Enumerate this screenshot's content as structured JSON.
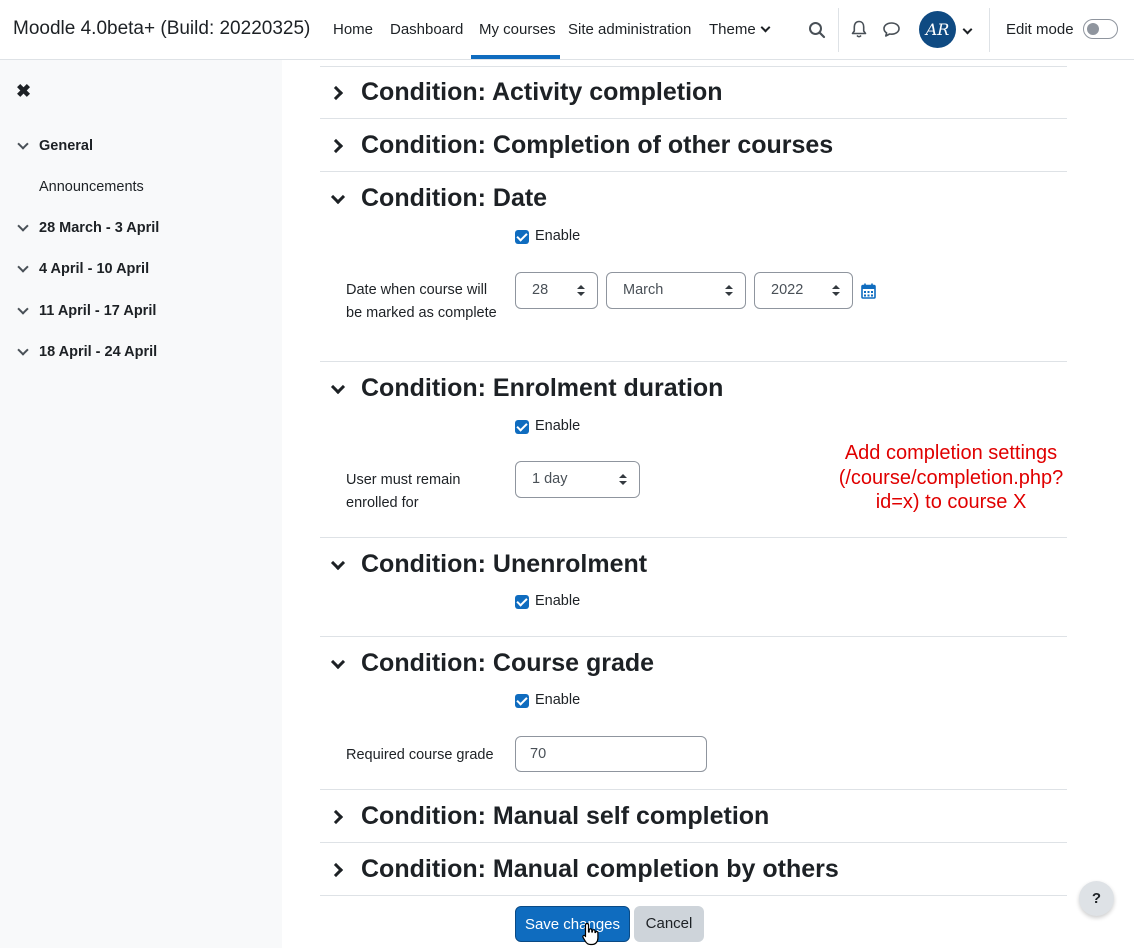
{
  "brand": "Moodle 4.0beta+ (Build: 20220325)",
  "nav": {
    "home": "Home",
    "dashboard": "Dashboard",
    "my_courses": "My courses",
    "site_admin": "Site administration",
    "theme": "Theme",
    "edit_mode": "Edit mode",
    "avatar_initials": "AR"
  },
  "sidebar": {
    "items": [
      {
        "label": "General"
      },
      {
        "label": "Announcements"
      },
      {
        "label": "28 March - 3 April"
      },
      {
        "label": "4 April - 10 April"
      },
      {
        "label": "11 April - 17 April"
      },
      {
        "label": "18 April - 24 April"
      }
    ]
  },
  "sections": {
    "activity": "Condition: Activity completion",
    "other_courses": "Condition: Completion of other courses",
    "date": "Condition: Date",
    "enrolment_duration": "Condition: Enrolment duration",
    "unenrolment": "Condition: Unenrolment",
    "course_grade": "Condition: Course grade",
    "manual_self": "Condition: Manual self completion",
    "manual_others": "Condition: Manual completion by others"
  },
  "enable_label": "Enable",
  "date_field": {
    "label": "Date when course will be marked as complete",
    "day": "28",
    "month": "March",
    "year": "2022"
  },
  "enrolment_field": {
    "label": "User must remain enrolled for",
    "value": "1 day"
  },
  "grade_field": {
    "label": "Required course grade",
    "value": "70"
  },
  "annotation": "Add completion settings (/course/completion.php?id=x) to course X",
  "buttons": {
    "save": "Save changes",
    "cancel": "Cancel",
    "help": "?"
  },
  "colors": {
    "accent": "#0f6cbf",
    "annotation": "#e00000"
  }
}
